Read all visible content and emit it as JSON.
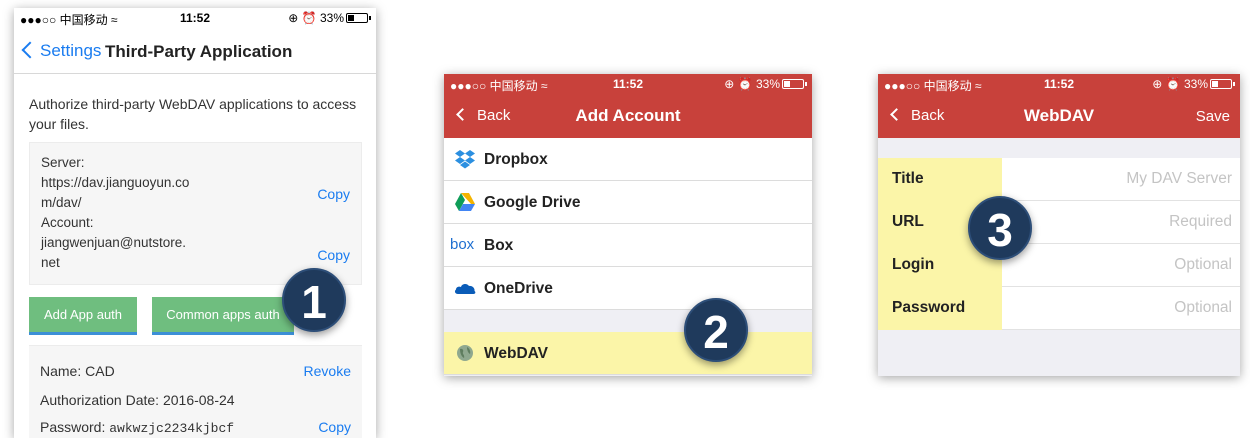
{
  "colors": {
    "ios_blue": "#1a7cf0",
    "nav_red": "#c8413b",
    "highlight_yellow": "#fbf5a8",
    "button_green": "#6fbe7f",
    "badge_navy": "#1f3a5c"
  },
  "status_bar": {
    "carrier": "●●●○○ 中国移动 ≈",
    "time": "11:52",
    "battery": "33%"
  },
  "step1": {
    "back_label": "Settings",
    "title": "Third-Party Application",
    "intro": "Authorize third-party WebDAV applications to access your files.",
    "server_label": "Server:",
    "server_value_1": "https://dav.jianguoyun.co",
    "server_value_2": "m/dav/",
    "account_label": "Account:",
    "account_value_1": "jiangwenjuan@nutstore.",
    "account_value_2": "net",
    "copy_label": "Copy",
    "add_app_auth": "Add App auth",
    "common_apps_auth": "Common apps auth",
    "auth_name": "Name: CAD",
    "revoke": "Revoke",
    "auth_date": "Authorization Date: 2016-08-24",
    "password_label": "Password:",
    "password_value": "awkwzjc2234kjbcf",
    "badge": "1"
  },
  "step2": {
    "back_label": "Back",
    "title": "Add Account",
    "items": [
      {
        "label": "Dropbox",
        "icon": "dropbox-icon"
      },
      {
        "label": "Google Drive",
        "icon": "google-drive-icon"
      },
      {
        "label": "Box",
        "icon": "box-icon"
      },
      {
        "label": "OneDrive",
        "icon": "onedrive-icon"
      },
      {
        "label": "WebDAV",
        "icon": "globe-icon"
      }
    ],
    "box_logo": "box",
    "badge": "2"
  },
  "step3": {
    "back_label": "Back",
    "title": "WebDAV",
    "save_label": "Save",
    "fields": [
      {
        "label": "Title",
        "placeholder": "My DAV Server"
      },
      {
        "label": "URL",
        "placeholder": "Required"
      },
      {
        "label": "Login",
        "placeholder": "Optional"
      },
      {
        "label": "Password",
        "placeholder": "Optional"
      }
    ],
    "badge": "3"
  }
}
